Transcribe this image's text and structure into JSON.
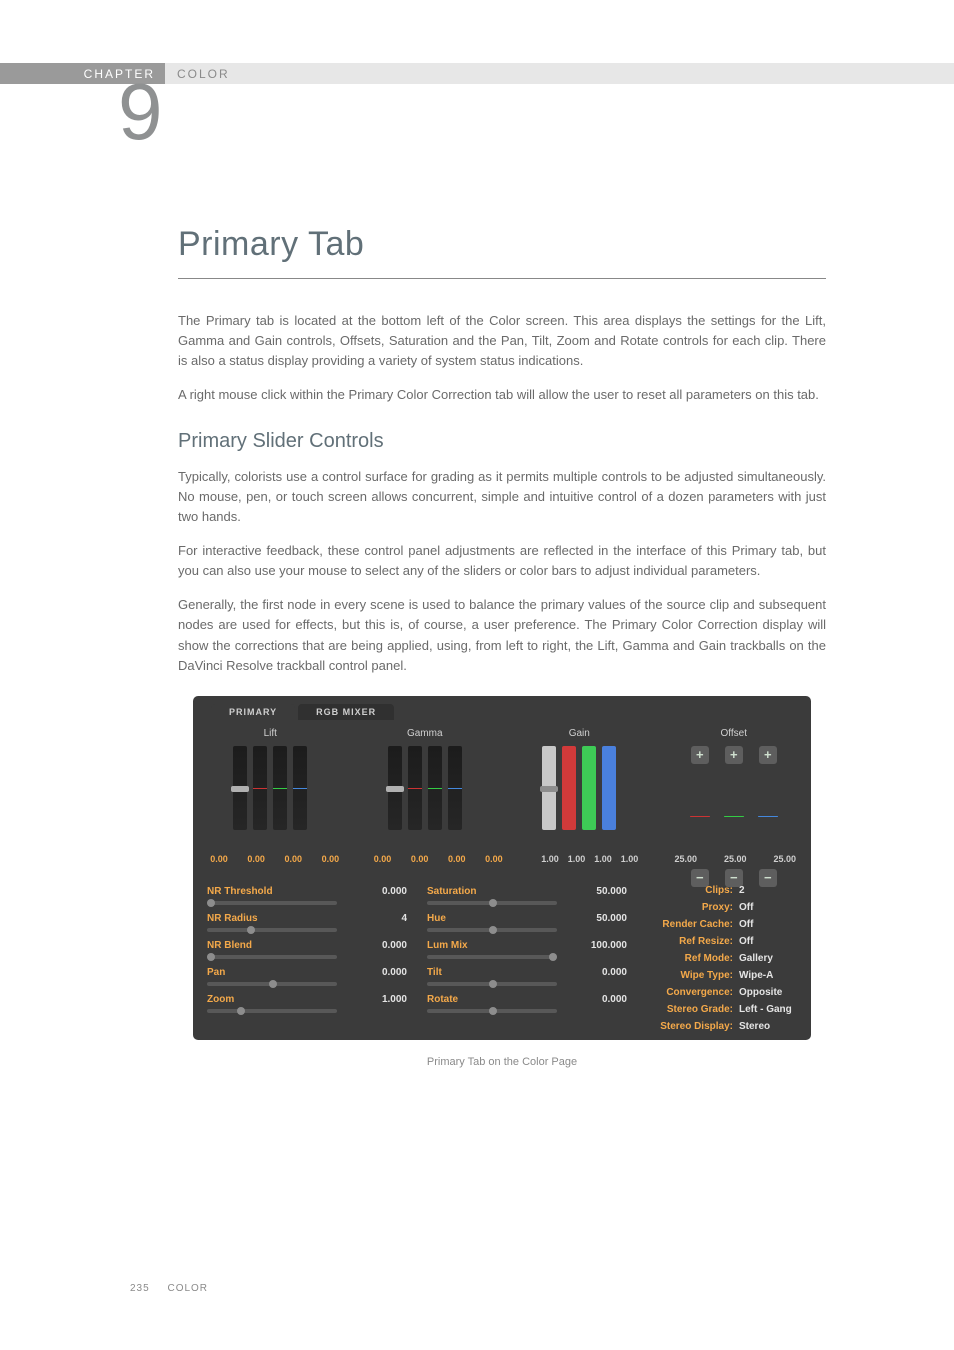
{
  "header": {
    "chapter_label": "CHAPTER",
    "section": "COLOR",
    "chapter_number": "9"
  },
  "title": "Primary Tab",
  "paragraphs": {
    "p1": "The Primary tab is located at the bottom left of the Color screen. This area displays the settings for the Lift, Gamma and Gain controls, Offsets, Saturation and the Pan, Tilt, Zoom and Rotate controls for each clip. There is also a status display providing a variety of system status indications.",
    "p2": "A right mouse click within the Primary Color Correction tab will allow the user to reset all parameters on this tab.",
    "subhead": "Primary Slider Controls",
    "p3": "Typically, colorists use a control surface for grading as it permits multiple controls to be adjusted simultaneously. No mouse, pen, or touch screen allows concurrent, simple and intuitive control of a dozen parameters with just two hands.",
    "p4": "For interactive feedback, these control panel adjustments are reflected in the interface of this Primary tab, but you can also use your mouse to select any of the sliders or color bars to adjust individual parameters.",
    "p5": "Generally, the first node in every scene is used to balance the primary values of the source clip and subsequent nodes are used for effects, but this is, of course, a user preference. The Primary Color Correction display will show the corrections that are being applied, using, from left to right, the Lift, Gamma and Gain trackballs on the DaVinci Resolve trackball control panel."
  },
  "screenshot": {
    "tabs": {
      "primary": "PRIMARY",
      "rgb_mixer": "RGB MIXER"
    },
    "columns": {
      "lift": "Lift",
      "gamma": "Gamma",
      "gain": "Gain",
      "offset": "Offset"
    },
    "plus": "+",
    "minus": "−",
    "values": {
      "lift": [
        "0.00",
        "0.00",
        "0.00",
        "0.00"
      ],
      "gamma": [
        "0.00",
        "0.00",
        "0.00",
        "0.00"
      ],
      "gain": [
        "1.00",
        "1.00",
        "1.00",
        "1.00"
      ],
      "offset": [
        "25.00",
        "25.00",
        "25.00"
      ]
    },
    "params_left": [
      {
        "label": "NR Threshold",
        "value": "0.000"
      },
      {
        "label": "NR Radius",
        "value": "4"
      },
      {
        "label": "NR Blend",
        "value": "0.000"
      },
      {
        "label": "Pan",
        "value": "0.000"
      },
      {
        "label": "Zoom",
        "value": "1.000"
      }
    ],
    "params_right": [
      {
        "label": "Saturation",
        "value": "50.000"
      },
      {
        "label": "Hue",
        "value": "50.000"
      },
      {
        "label": "Lum Mix",
        "value": "100.000"
      },
      {
        "label": "Tilt",
        "value": "0.000"
      },
      {
        "label": "Rotate",
        "value": "0.000"
      }
    ],
    "status": [
      {
        "label": "Clips:",
        "value": "2"
      },
      {
        "label": "Proxy:",
        "value": "Off"
      },
      {
        "label": "Render Cache:",
        "value": "Off"
      },
      {
        "label": "Ref Resize:",
        "value": "Off"
      },
      {
        "label": "Ref Mode:",
        "value": "Gallery"
      },
      {
        "label": "Wipe Type:",
        "value": "Wipe-A"
      },
      {
        "label": "Convergence:",
        "value": "Opposite"
      },
      {
        "label": "Stereo Grade:",
        "value": "Left - Gang"
      },
      {
        "label": "Stereo Display:",
        "value": "Stereo"
      }
    ]
  },
  "caption": "Primary Tab on the Color Page",
  "footer": {
    "page": "235",
    "section": "COLOR"
  }
}
